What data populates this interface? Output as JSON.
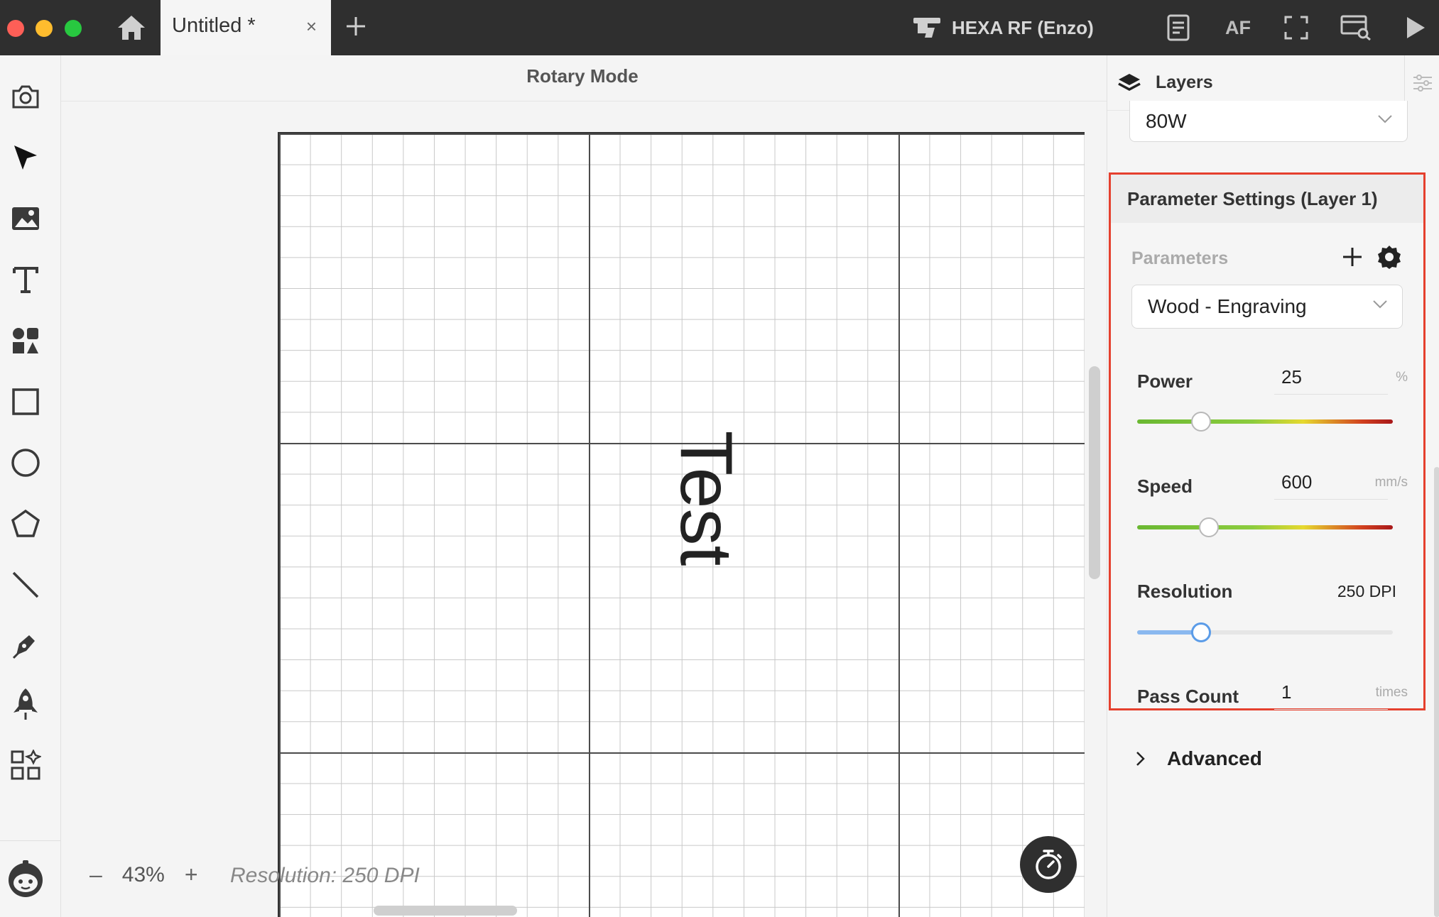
{
  "titlebar": {
    "tab_title": "Untitled *",
    "tab_close": "×",
    "device_name": "HEXA RF (Enzo)",
    "af_label": "AF"
  },
  "canvas": {
    "mode_label": "Rotary Mode",
    "text_object": "Test",
    "zoom_value": "43%",
    "zoom_minus": "–",
    "zoom_plus": "+",
    "resolution_label": "Resolution: 250 DPI"
  },
  "right_panel": {
    "layers_title": "Layers",
    "laser_power_select": "80W",
    "param_settings_title": "Parameter Settings (Layer 1)",
    "parameters_label": "Parameters",
    "preset_select": "Wood - Engraving",
    "power": {
      "label": "Power",
      "value": "25",
      "unit": "%",
      "level": 0.25
    },
    "speed": {
      "label": "Speed",
      "value": "600",
      "unit": "mm/s",
      "level": 0.28
    },
    "resolution": {
      "label": "Resolution",
      "value": "250 DPI",
      "level": 0.25
    },
    "pass_count": {
      "label": "Pass Count",
      "value": "1",
      "unit": "times"
    },
    "advanced_label": "Advanced"
  },
  "colors": {
    "accent_red": "#e5402e",
    "titlebar_bg": "#2f2f2f",
    "slider_blue": "#5b9ce8"
  }
}
